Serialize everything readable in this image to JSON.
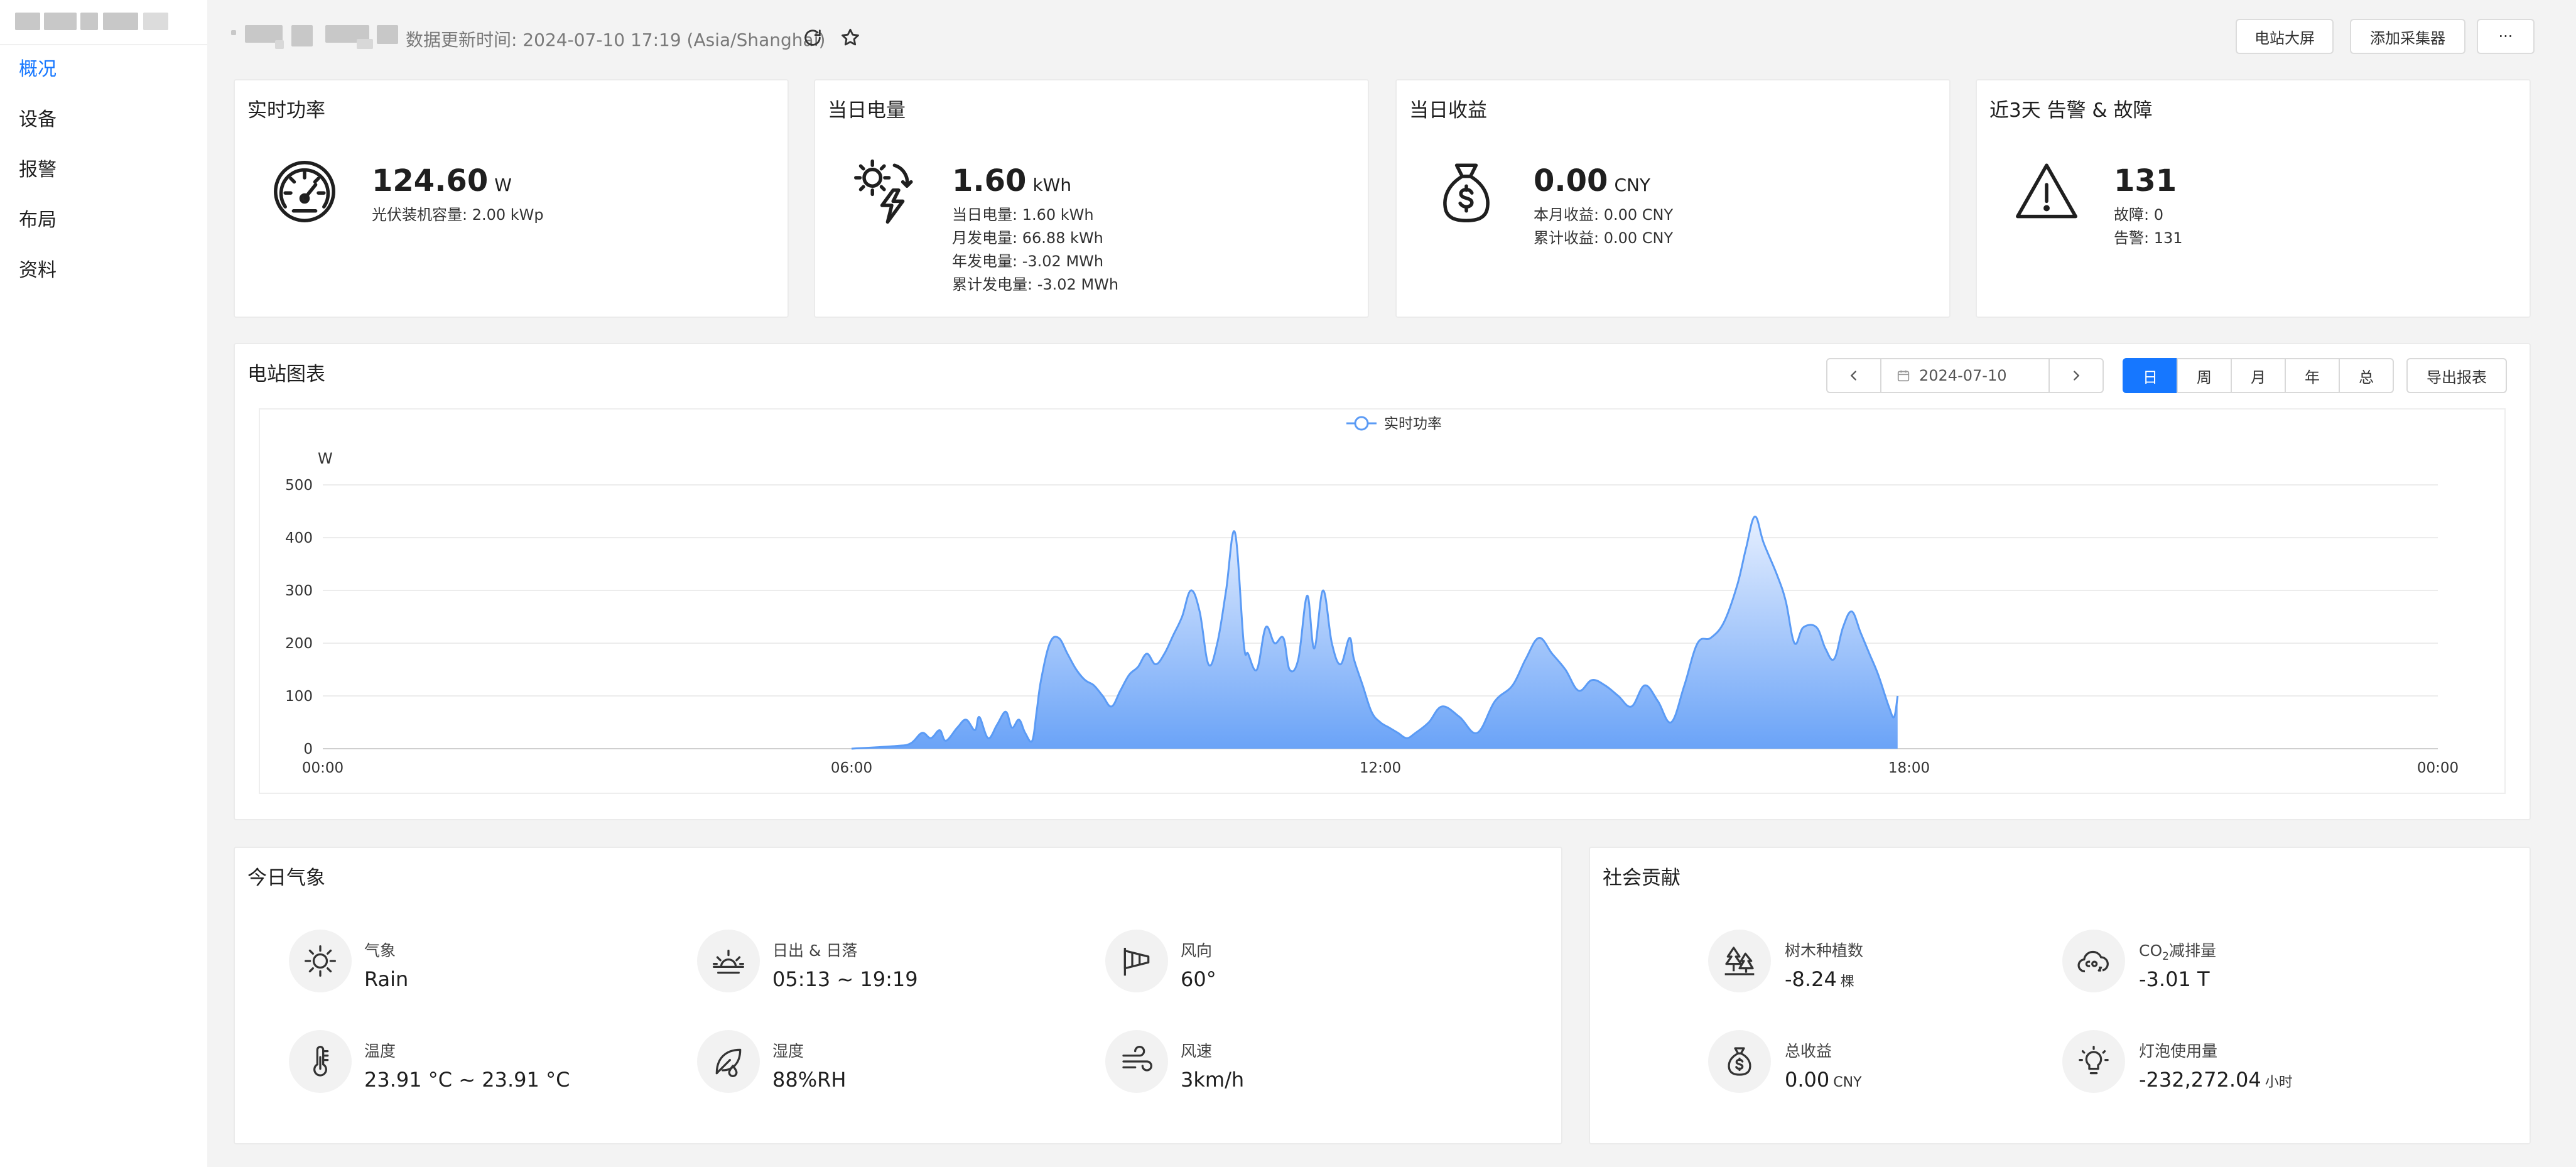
{
  "sidebar": {
    "items": [
      {
        "label": "概况",
        "active": true
      },
      {
        "label": "设备"
      },
      {
        "label": "报警"
      },
      {
        "label": "布局"
      },
      {
        "label": "资料"
      }
    ]
  },
  "header": {
    "update_text": "数据更新时间: 2024-07-10 17:19 (Asia/Shanghai)",
    "buttons": {
      "big_screen": "电站大屏",
      "add_collector": "添加采集器",
      "more": "···"
    }
  },
  "cards": {
    "power": {
      "title": "实时功率",
      "value": "124.60",
      "unit": "W",
      "sub1": "光伏装机容量: 2.00 kWp"
    },
    "energy": {
      "title": "当日电量",
      "value": "1.60",
      "unit": "kWh",
      "sub1": "当日电量: 1.60 kWh",
      "sub2": "月发电量: 66.88 kWh",
      "sub3": "年发电量: -3.02 MWh",
      "sub4": "累计发电量: -3.02 MWh"
    },
    "income": {
      "title": "当日收益",
      "value": "0.00",
      "unit": "CNY",
      "sub1": "本月收益: 0.00 CNY",
      "sub2": "累计收益: 0.00 CNY"
    },
    "alarm": {
      "title": "近3天 告警 & 故障",
      "value": "131",
      "sub1": "故障: 0",
      "sub2": "告警: 131"
    }
  },
  "chart_panel": {
    "title": "电站图表",
    "date": "2024-07-10",
    "periods": [
      "日",
      "周",
      "月",
      "年",
      "总"
    ],
    "active_period": "日",
    "export_label": "导出报表"
  },
  "chart_data": {
    "type": "area",
    "legend": "实时功率",
    "ylabel": "W",
    "ylim": [
      0,
      500
    ],
    "yticks": [
      "500",
      "400",
      "300",
      "200",
      "100",
      "0"
    ],
    "xticks": [
      "00:00",
      "06:00",
      "12:00",
      "18:00",
      "00:00"
    ],
    "xlim_hours": [
      0,
      24
    ],
    "series": [
      {
        "name": "实时功率",
        "x": [
          6.0,
          6.5,
          6.67,
          6.8,
          6.9,
          7.0,
          7.07,
          7.2,
          7.3,
          7.4,
          7.45,
          7.55,
          7.65,
          7.75,
          7.82,
          7.9,
          7.97,
          8.05,
          8.1,
          8.15,
          8.25,
          8.35,
          8.45,
          8.55,
          8.65,
          8.75,
          8.85,
          8.95,
          9.05,
          9.15,
          9.25,
          9.35,
          9.45,
          9.55,
          9.65,
          9.75,
          9.85,
          9.95,
          10.05,
          10.15,
          10.25,
          10.35,
          10.45,
          10.5,
          10.6,
          10.7,
          10.8,
          10.9,
          10.97,
          11.07,
          11.17,
          11.25,
          11.35,
          11.45,
          11.55,
          11.65,
          11.7,
          11.8,
          11.9,
          12.0,
          12.1,
          12.2,
          12.3,
          12.4,
          12.55,
          12.7,
          12.9,
          13.1,
          13.3,
          13.5,
          13.65,
          13.8,
          13.95,
          14.1,
          14.25,
          14.4,
          14.55,
          14.7,
          14.85,
          15.0,
          15.15,
          15.3,
          15.45,
          15.6,
          15.75,
          15.9,
          16.05,
          16.15,
          16.25,
          16.35,
          16.5,
          16.6,
          16.7,
          16.8,
          16.95,
          17.05,
          17.15,
          17.25,
          17.35,
          17.45,
          17.55,
          17.65,
          17.77,
          17.83,
          17.87
        ],
        "y": [
          0,
          5,
          10,
          30,
          20,
          35,
          15,
          40,
          55,
          35,
          60,
          20,
          45,
          70,
          40,
          55,
          30,
          15,
          70,
          130,
          200,
          210,
          180,
          150,
          130,
          120,
          100,
          80,
          110,
          140,
          155,
          180,
          160,
          180,
          215,
          250,
          300,
          260,
          160,
          200,
          300,
          410,
          200,
          180,
          150,
          230,
          200,
          210,
          150,
          170,
          290,
          190,
          300,
          200,
          160,
          210,
          170,
          120,
          70,
          50,
          40,
          30,
          20,
          30,
          50,
          80,
          60,
          30,
          90,
          120,
          170,
          210,
          180,
          150,
          110,
          130,
          120,
          100,
          80,
          120,
          90,
          50,
          120,
          200,
          210,
          240,
          310,
          380,
          440,
          390,
          330,
          280,
          200,
          230,
          230,
          190,
          170,
          230,
          260,
          220,
          180,
          140,
          80,
          60,
          100
        ]
      }
    ]
  },
  "weather": {
    "title": "今日气象",
    "items": [
      {
        "label": "气象",
        "value": "Rain",
        "icon": "sun-icon"
      },
      {
        "label": "日出 & 日落",
        "value": "05:13 ~ 19:19",
        "icon": "sunrise-icon"
      },
      {
        "label": "风向",
        "value": "60°",
        "icon": "windsock-icon"
      },
      {
        "label": "温度",
        "value": "23.91 °C ~ 23.91 °C",
        "icon": "thermometer-icon"
      },
      {
        "label": "湿度",
        "value": "88%RH",
        "icon": "leaf-drop-icon"
      },
      {
        "label": "风速",
        "value": "3km/h",
        "icon": "wind-icon"
      }
    ]
  },
  "contribution": {
    "title": "社会贡献",
    "trees": {
      "label": "树木种植数",
      "value": "-8.24",
      "unit": "棵"
    },
    "co2": {
      "label_prefix": "CO",
      "label_sub": "2",
      "label_suffix": "减排量",
      "value": "-3.01 T"
    },
    "income": {
      "label": "总收益",
      "value": "0.00",
      "unit": "CNY"
    },
    "bulb": {
      "label": "灯泡使用量",
      "value": "-232,272.04",
      "unit": "小时"
    }
  }
}
